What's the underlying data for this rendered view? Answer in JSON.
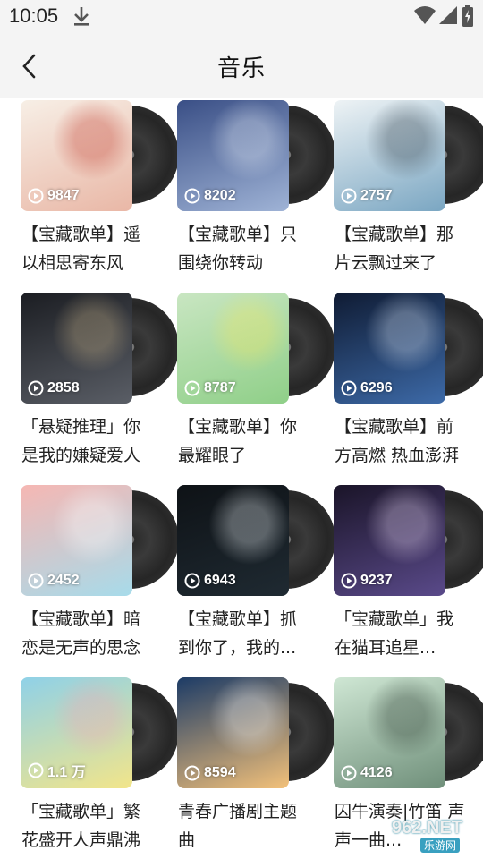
{
  "status": {
    "time": "10:05"
  },
  "header": {
    "title": "音乐"
  },
  "playlists": [
    {
      "count": "9847",
      "title": "【宝藏歌单】遥以相思寄东风",
      "c1": "#f7efe6",
      "c2": "#e9b7a6",
      "accent": "#c0392b"
    },
    {
      "count": "8202",
      "title": "【宝藏歌单】只围绕你转动",
      "c1": "#3a4f86",
      "c2": "#9fb3d6",
      "accent": "#e6eef8"
    },
    {
      "count": "2757",
      "title": "【宝藏歌单】那片云飘过来了",
      "c1": "#eef3f5",
      "c2": "#7aa6c2",
      "accent": "#2d3a44"
    },
    {
      "count": "2858",
      "title": "「悬疑推理」你是我的嫌疑爱人",
      "c1": "#1b1d22",
      "c2": "#5a5e66",
      "accent": "#c9b48a"
    },
    {
      "count": "8787",
      "title": "【宝藏歌单】你最耀眼了",
      "c1": "#c9e6c2",
      "c2": "#8fcf88",
      "accent": "#f3e860"
    },
    {
      "count": "6296",
      "title": "【宝藏歌单】前方高燃 热血澎湃",
      "c1": "#0f1b33",
      "c2": "#3d6aa8",
      "accent": "#dbe6f5"
    },
    {
      "count": "2452",
      "title": "【宝藏歌单】暗恋是无声的思念",
      "c1": "#f6b7b3",
      "c2": "#a7dbea",
      "accent": "#ffffff"
    },
    {
      "count": "6943",
      "title": "【宝藏歌单】抓到你了，我的...",
      "c1": "#0e1216",
      "c2": "#1f2a32",
      "accent": "#e8eef2"
    },
    {
      "count": "9237",
      "title": "「宝藏歌单」我在猫耳追星...",
      "c1": "#1a1428",
      "c2": "#5a4a8a",
      "accent": "#e9d9f5"
    },
    {
      "count": "1.1 万",
      "title": "「宝藏歌单」繁花盛开人声鼎沸",
      "c1": "#8fd1e8",
      "c2": "#f2e58a",
      "accent": "#f0a6b8"
    },
    {
      "count": "8594",
      "title": "青春广播剧主题曲",
      "c1": "#1c3b66",
      "c2": "#f3c17a",
      "accent": "#ffffff"
    },
    {
      "count": "4126",
      "title": "囚牛演奏|竹笛 声声一曲...",
      "c1": "#cfe7d4",
      "c2": "#6f8f7a",
      "accent": "#2b3a30"
    }
  ],
  "watermark": {
    "text": "962.NET",
    "sub": "乐游网"
  }
}
